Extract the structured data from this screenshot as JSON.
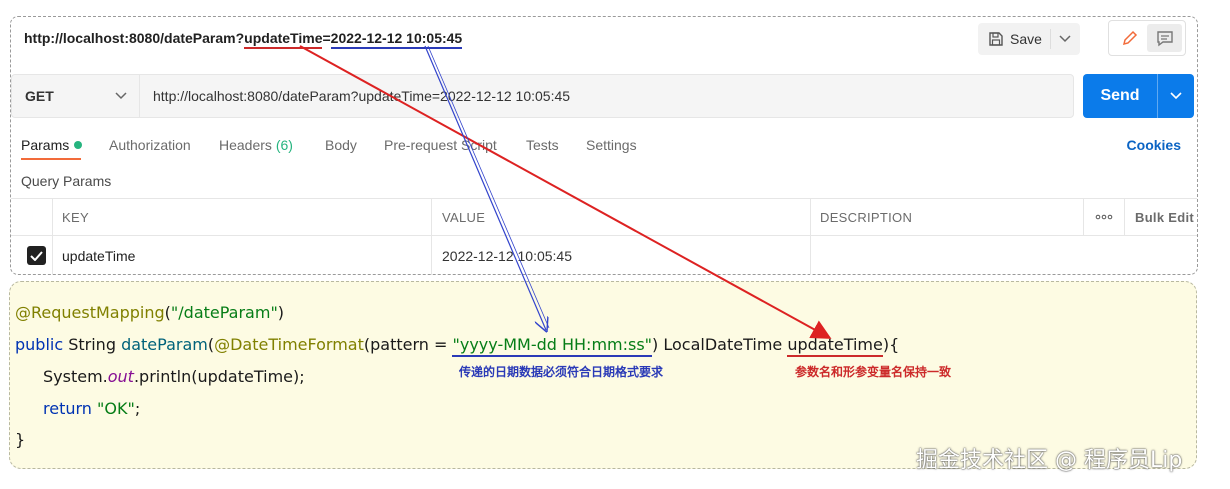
{
  "header": {
    "url_prefix": "http://localhost:8080/dateParam?",
    "url_key": "updateTime",
    "url_eq": "=",
    "url_value": "2022-12-12 10:05:45",
    "save_label": "Save"
  },
  "request": {
    "method": "GET",
    "url": "http://localhost:8080/dateParam?updateTime=2022-12-12 10:05:45",
    "send_label": "Send"
  },
  "tabs": [
    {
      "label": "Params"
    },
    {
      "label": "Authorization"
    },
    {
      "label": "Headers",
      "count": "(6)"
    },
    {
      "label": "Body"
    },
    {
      "label": "Pre-request Script"
    },
    {
      "label": "Tests"
    },
    {
      "label": "Settings"
    }
  ],
  "cookies_label": "Cookies",
  "query_params": {
    "section_label": "Query Params",
    "columns": {
      "key": "KEY",
      "value": "VALUE",
      "description": "DESCRIPTION",
      "bulk_edit": "Bulk Edit"
    },
    "rows": [
      {
        "key": "updateTime",
        "value": "2022-12-12 10:05:45",
        "description": "",
        "checked": true
      }
    ]
  },
  "code": {
    "l1_anno": "@RequestMapping",
    "l1_paren_open": "(",
    "l1_str": "\"/dateParam\"",
    "l1_paren_close": ")",
    "l2_public": "public",
    "l2_type": " String ",
    "l2_method": "dateParam",
    "l2_paren": "(",
    "l2_anno": "@DateTimeFormat",
    "l2_pattern_open": "(pattern = ",
    "l2_pattern_str": "\"yyyy-MM-dd HH:mm:ss\"",
    "l2_pattern_close": ") LocalDateTime ",
    "l2_param": "updateTime",
    "l2_end": "){",
    "l3_system": "System.",
    "l3_out": "out",
    "l3_rest": ".println(updateTime);",
    "l4_return": "return ",
    "l4_str": "\"OK\"",
    "l4_semi": ";",
    "l5": "}"
  },
  "annotations": {
    "format_note": "传递的日期数据必须符合日期格式要求",
    "name_note": "参数名和形参变量名保持一致"
  },
  "watermark": "掘金技术社区 @ 程序员Lip",
  "colors": {
    "send": "#0b7bea",
    "tab_accent": "#f26b3a",
    "dot": "#26b47f",
    "arrow_red": "#dd2222",
    "arrow_blue": "#3344cc"
  }
}
